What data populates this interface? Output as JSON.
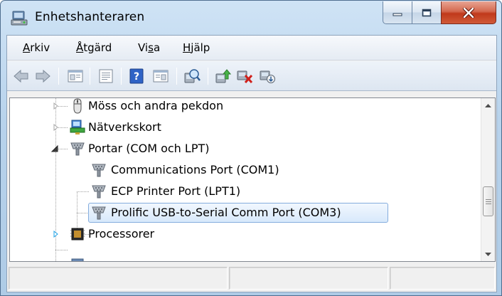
{
  "window": {
    "title": "Enhetshanteraren",
    "title_icon": "device-manager-icon"
  },
  "menu": {
    "items": [
      {
        "label_underlined": "A",
        "label_rest": "rkiv",
        "label_prefix": ""
      },
      {
        "label_underlined": "Å",
        "label_rest": "tgärd",
        "label_prefix": ""
      },
      {
        "label_prefix": "Vi",
        "label_underlined": "s",
        "label_rest": "a"
      },
      {
        "label_underlined": "H",
        "label_rest": "jälp",
        "label_prefix": ""
      }
    ]
  },
  "toolbar": {
    "buttons": [
      "back-arrow-icon",
      "forward-arrow-icon",
      "show-hide-console-tree-icon",
      "properties-icon",
      "help-icon",
      "action-pane-icon",
      "scan-hardware-changes-icon",
      "update-driver-icon",
      "uninstall-device-icon",
      "disable-device-icon"
    ]
  },
  "tree": {
    "items": [
      {
        "label": "Möss och andra pekdon",
        "icon": "mouse-icon",
        "expander": "collapsed"
      },
      {
        "label": "Nätverkskort",
        "icon": "network-adapter-icon",
        "expander": "collapsed"
      },
      {
        "label": "Portar (COM och LPT)",
        "icon": "port-icon",
        "expander": "expanded"
      },
      {
        "label": "Communications Port (COM1)",
        "icon": "port-icon",
        "expander": "none"
      },
      {
        "label": "ECP Printer Port (LPT1)",
        "icon": "port-icon",
        "expander": "none"
      },
      {
        "label": "Prolific USB-to-Serial Comm Port (COM3)",
        "icon": "port-icon",
        "expander": "none",
        "selected": true
      },
      {
        "label": "Processorer",
        "icon": "processor-icon",
        "expander": "collapsed-hover"
      }
    ]
  },
  "status": {
    "panes": [
      "",
      "",
      ""
    ]
  }
}
